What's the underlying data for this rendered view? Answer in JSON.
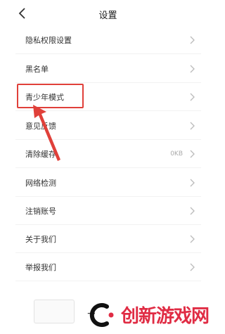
{
  "header": {
    "title": "设置"
  },
  "settings": {
    "items": [
      {
        "label": "隐私权限设置",
        "value": ""
      },
      {
        "label": "黑名单",
        "value": ""
      },
      {
        "label": "青少年模式",
        "value": ""
      },
      {
        "label": "意见反馈",
        "value": ""
      },
      {
        "label": "清除缓存",
        "value": "0KB"
      },
      {
        "label": "网络检测",
        "value": ""
      },
      {
        "label": "注销账号",
        "value": ""
      },
      {
        "label": "关于我们",
        "value": ""
      },
      {
        "label": "举报我们",
        "value": ""
      }
    ]
  },
  "annotation": {
    "highlight_color": "#e0403a"
  },
  "watermark": {
    "text": "创新游戏网",
    "color": "#e02c44"
  }
}
